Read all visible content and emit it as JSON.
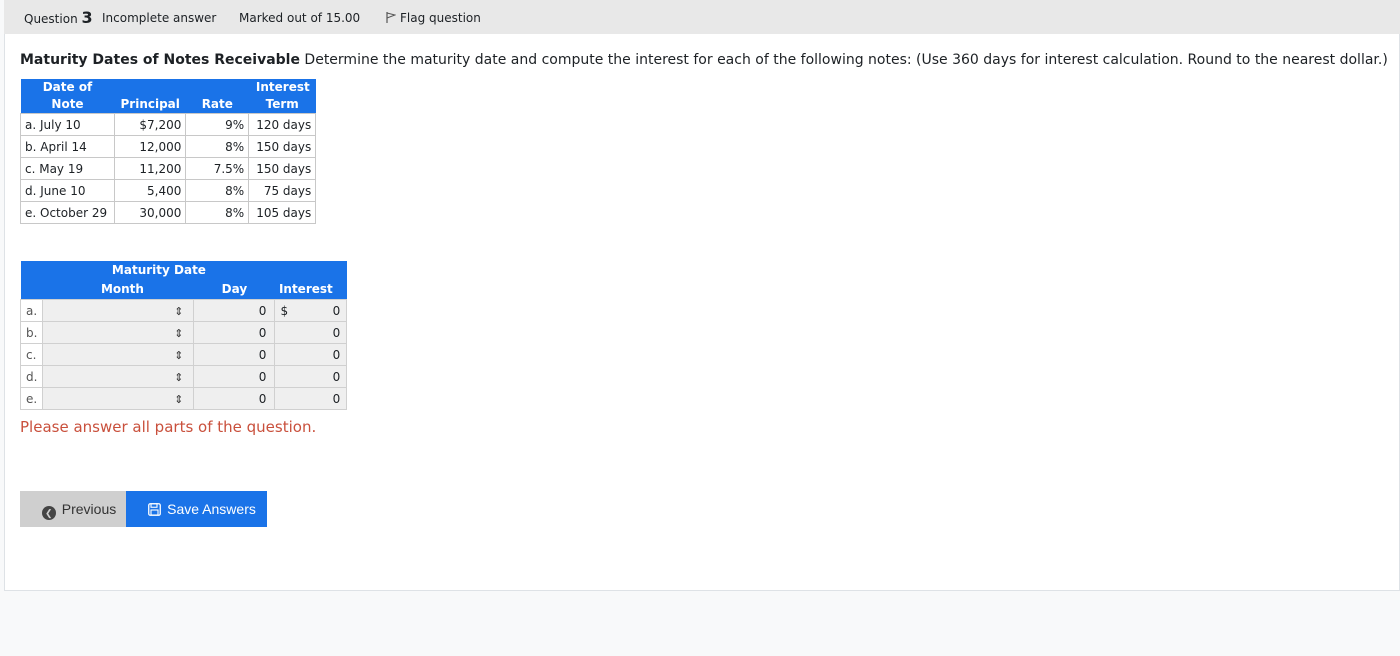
{
  "header": {
    "question_label": "Question",
    "question_number": "3",
    "status": "Incomplete answer",
    "marks": "Marked out of 15.00",
    "flag_label": "Flag question"
  },
  "prompt": {
    "title": "Maturity Dates of Notes Receivable",
    "text": " Determine the maturity date and compute the interest for each of the following notes: (Use 360 days for interest calculation. Round to the nearest dollar.)"
  },
  "info_table": {
    "headers": {
      "date_top": "Date of",
      "date_bottom": "Note",
      "principal": "Principal",
      "rate_top": "Interest",
      "rate_bottom": "Rate",
      "term": "Term"
    },
    "rows": [
      {
        "date": "a. July 10",
        "principal": "$7,200",
        "rate": "9%",
        "term": "120 days"
      },
      {
        "date": "b. April 14",
        "principal": "12,000",
        "rate": "8%",
        "term": "150 days"
      },
      {
        "date": "c. May 19",
        "principal": "11,200",
        "rate": "7.5%",
        "term": "150 days"
      },
      {
        "date": "d. June 10",
        "principal": "5,400",
        "rate": "8%",
        "term": "75 days"
      },
      {
        "date": "e. October 29",
        "principal": "30,000",
        "rate": "8%",
        "term": "105 days"
      }
    ]
  },
  "answer_table": {
    "headers": {
      "maturity_date": "Maturity Date",
      "month": "Month",
      "day": "Day",
      "interest": "Interest"
    },
    "currency": "$",
    "rows": [
      {
        "letter": "a.",
        "month": "",
        "day": "0",
        "interest": "0"
      },
      {
        "letter": "b.",
        "month": "",
        "day": "0",
        "interest": "0"
      },
      {
        "letter": "c.",
        "month": "",
        "day": "0",
        "interest": "0"
      },
      {
        "letter": "d.",
        "month": "",
        "day": "0",
        "interest": "0"
      },
      {
        "letter": "e.",
        "month": "",
        "day": "0",
        "interest": "0"
      }
    ]
  },
  "error_message": "Please answer all parts of the question.",
  "buttons": {
    "previous": "Previous",
    "save": "Save Answers"
  },
  "colors": {
    "accent": "#1a73e8",
    "error": "#c9503c"
  }
}
